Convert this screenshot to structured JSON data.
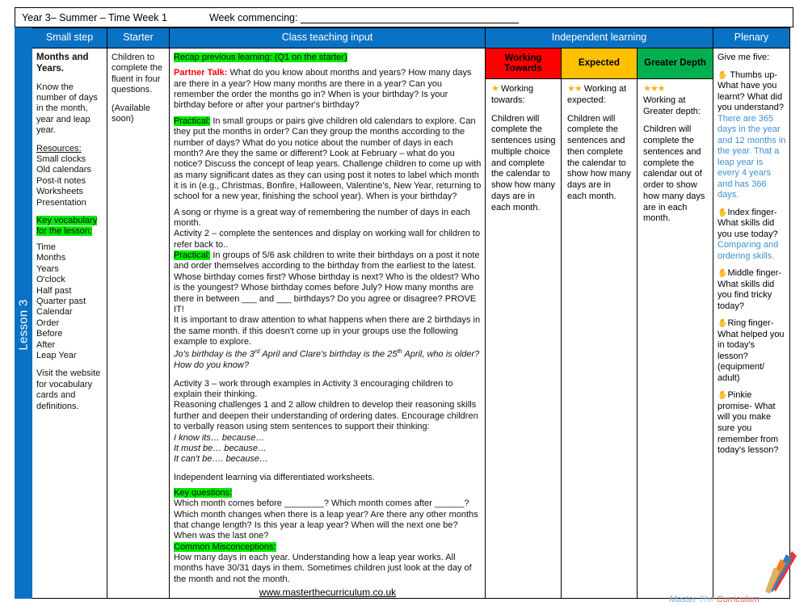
{
  "header": {
    "left": "Year 3– Summer – Time  Week 1",
    "right_label": "Week commencing:"
  },
  "lesson_tab": "Lesson 3",
  "columns": {
    "small_step": "Small step",
    "starter": "Starter",
    "class_teaching": "Class teaching input",
    "independent": "Independent learning",
    "plenary": "Plenary"
  },
  "small_step": {
    "title": "Months and Years.",
    "objective": "Know the number of days in the month, year and leap year.",
    "resources_label": "Resources:",
    "resources": [
      "Small clocks",
      "Old calendars",
      "Post-it notes",
      "Worksheets",
      "Presentation"
    ],
    "vocab_label": "Key vocabulary for the lesson:",
    "vocabulary": [
      "Time",
      "Months",
      "Years",
      "O'clock",
      "Half past",
      "Quarter past",
      "Calendar",
      "Order",
      "Before",
      "After",
      "Leap Year"
    ],
    "vocab_note": "Visit the website for vocabulary cards and definitions."
  },
  "starter": {
    "text": "Children to complete the fluent in four questions.",
    "note": "(Available soon)"
  },
  "class_teaching": {
    "recap_label": "Recap previous learning: (Q1 on the starter)",
    "partner_talk_label": "Partner Talk:",
    "partner_talk_body": "What do you know about months and years? How many days are there in a year? How many months are there in a year?  Can you remember the order the months go in?   When is your birthday?  Is your birthday before or after your partner's birthday?",
    "practical1_label": "Practical:",
    "practical1_body": "In small groups or pairs give children old calendars to explore. Can they put the months in order?  Can they group the months according to the number of days? What do you notice about the number of days in each month? Are they the same or different?  Look at February – what do you notice?  Discuss the concept of leap years.  Challenge children to come up with as many significant dates as they can using post it notes to label which month it is in (e.g., Christmas, Bonfire, Halloween, Valentine's, New Year, returning to school for a new year, finishing the school year).  When is your birthday?",
    "song_line": "A song or rhyme is a great way of remembering the number of days in each month.",
    "activity2": "Activity 2 – complete the sentences and display on working wall for children to refer back to..",
    "practical2_label": "Practical:",
    "practical2_body": "In groups of 5/6 ask children to write their birthdays on a post it note and order themselves according to the birthday from the earliest to the latest. Whose birthday comes first?  Whose birthday is next?  Who is the oldest? Who is the youngest?  Whose birthday comes before July?  How many months are there in between ___ and ___ birthdays?   Do you agree or disagree?  PROVE IT!",
    "attention_line": "It is important to draw attention to what happens when there are 2 birthdays in the same month. if this doesn't come up in your groups use the following example to explore.",
    "example_pre": "Jo's birthday is the 3",
    "example_sup1": "rd",
    "example_mid": " April and Clare's birthday is the 25",
    "example_sup2": "th",
    "example_post": " April, who is older? How do you know?",
    "activity3": "Activity 3 – work through examples in Activity 3 encouraging children to explain their thinking.",
    "reasoning": "Reasoning challenges 1 and 2 allow children to develop their reasoning skills further and deepen their understanding of ordering dates. Encourage children to verbally reason using stem sentences to support their thinking:",
    "stems": [
      "I know its… because…",
      "It must be… because…",
      "It can't be…. because…"
    ],
    "independent_line": "Independent learning via differentiated worksheets.",
    "key_questions_label": "Key questions:",
    "key_questions_body": "Which month comes before ________?  Which month comes after ______? Which month changes when there is a leap year? Are there any other months that change length? Is this year a leap year? When will the next one be? When was the last one?",
    "misconceptions_label": "Common Misconceptions:",
    "misconceptions_body": "How many days in each year. Understanding how a leap year works. All months have 30/31 days in them.  Sometimes children just look at the day of the month and not the month.",
    "website": "www.masterthecurriculum.co.uk"
  },
  "independent": {
    "working_towards": {
      "heading": "Working Towards",
      "stars": "★",
      "subtitle": "Working towards:",
      "body": "Children will complete the sentences using multiple choice and complete the calendar to show how many days are in each month."
    },
    "expected": {
      "heading": "Expected",
      "stars": "★★",
      "subtitle": "Working at expected:",
      "body": "Children will complete the sentences and then complete the calendar to show how many days are in each month."
    },
    "greater_depth": {
      "heading": "Greater Depth",
      "stars": "★★★",
      "subtitle": "Working at Greater depth:",
      "body": "Children will complete the sentences and complete the calendar out of order to show how many days are in each month."
    }
  },
  "plenary": {
    "intro": "Give me five:",
    "thumbs_q": "Thumbs up- What have you learnt? What did you understand?",
    "thumbs_a": "There are 365 days in the year and 12 months in the year. That a leap year is every 4 years and has 366 days.",
    "index_q": "Index finger- What skills did you use today?",
    "index_a": "Comparing and ordering skills.",
    "middle_q": "Middle finger- What skills did you find tricky today?",
    "ring_q": "Ring finger- What helped you in today's lesson? (equipment/ adult)",
    "pinkie_q": "Pinkie promise- What will you make sure you remember from today's lesson?"
  },
  "footer_brand": {
    "word1": "Master",
    "word2": "The",
    "word3": "Curriculum"
  },
  "colors": {
    "header_blue": "#0A72C4",
    "working_towards": "#FF0000",
    "expected": "#FFC000",
    "greater_depth": "#00B050",
    "highlight_green": "#00E800",
    "answer_blue": "#3C8FD4"
  }
}
